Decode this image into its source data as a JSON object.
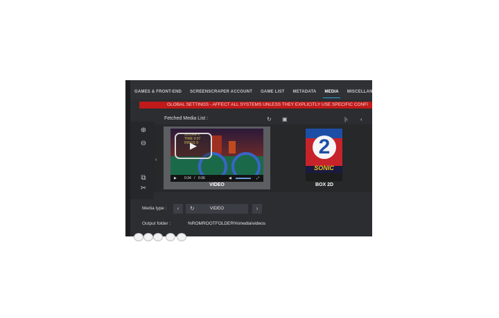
{
  "tabs": [
    {
      "label": "GAMES & FRONT-END",
      "active": false
    },
    {
      "label": "SCREENSCRAPER ACCOUNT",
      "active": false
    },
    {
      "label": "GAME LIST",
      "active": false
    },
    {
      "label": "METADATA",
      "active": false
    },
    {
      "label": "MEDIA",
      "active": true
    },
    {
      "label": "MISCELLAN",
      "active": false
    }
  ],
  "banner": "GLOBAL SETTINGS - AFFECT ALL SYSTEMS UNLESS THEY EXPLICITLY USE SPECIFIC CONFI",
  "media_list_title": "Fetched Media List :",
  "video": {
    "hud": [
      "SCORE 0",
      "TIME 0:07",
      "RINGS 0"
    ],
    "time_current": "0:34",
    "time_total": "0:36",
    "label": "VIDEO"
  },
  "box": {
    "number": "2",
    "title": "SONIC",
    "label": "BOX 2D"
  },
  "media_type": {
    "label": "Media type :",
    "value": "VIDEO"
  },
  "output_folder": {
    "label": "Output folder :",
    "value": "%ROMROOTFOLDER%\\media\\videos"
  },
  "colors": {
    "accent": "#2aa4e0",
    "banner": "#c01a1a",
    "background": "#2b2d30"
  }
}
